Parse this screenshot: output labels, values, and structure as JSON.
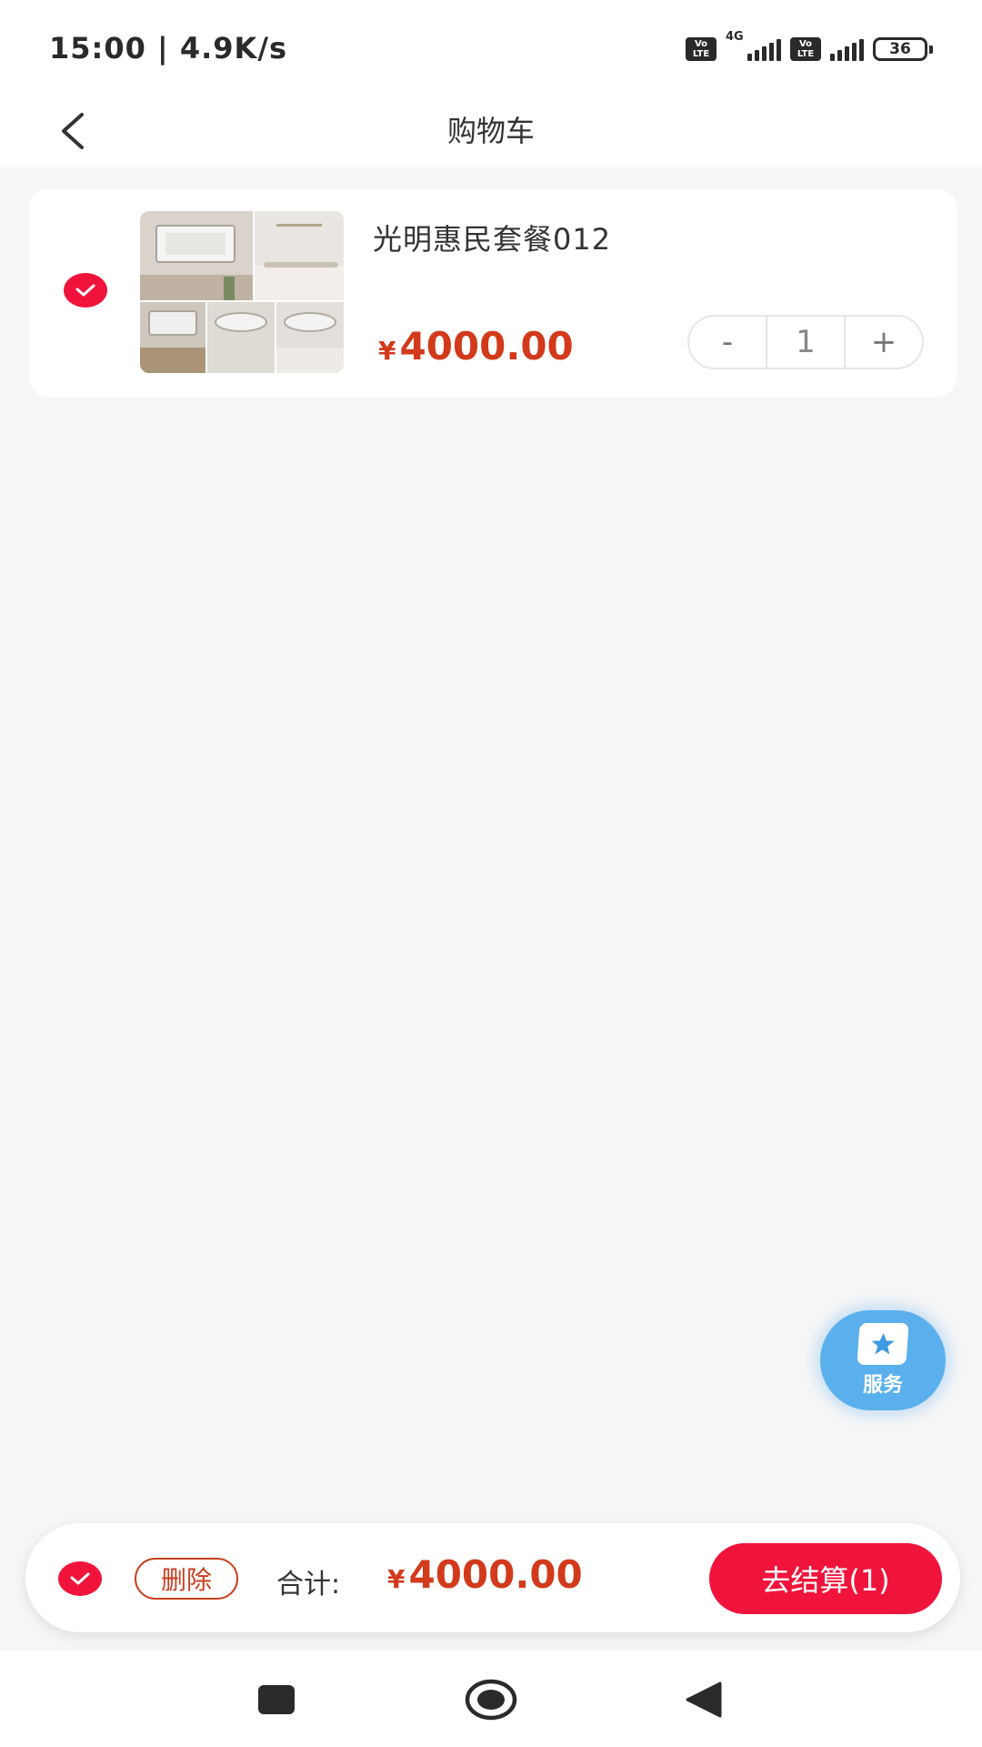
{
  "status_bar": {
    "time": "15:00 | 4.9K/s",
    "volte_label": "Vo LTE",
    "network": "4G",
    "battery": "36"
  },
  "nav": {
    "title": "购物车",
    "back_icon": "chevron-left-icon"
  },
  "cart": {
    "items": [
      {
        "name": "光明惠民套餐012",
        "currency": "¥",
        "price": "4000.00",
        "quantity": "1",
        "selected": true,
        "decrement_label": "-",
        "increment_label": "+"
      }
    ]
  },
  "service": {
    "label": "服务",
    "icon": "star-card-icon"
  },
  "checkout": {
    "delete_label": "删除",
    "total_label": "合计:",
    "currency": "¥",
    "total": "4000.00",
    "checkout_label": "去结算(1)",
    "all_selected": true
  },
  "colors": {
    "accent": "#f0143c",
    "price": "#d23a1b",
    "service": "#5ab0ec",
    "background": "#f6f6f6"
  },
  "system_nav": {
    "icons": [
      "square-icon",
      "home-circle-icon",
      "back-triangle-icon"
    ]
  }
}
